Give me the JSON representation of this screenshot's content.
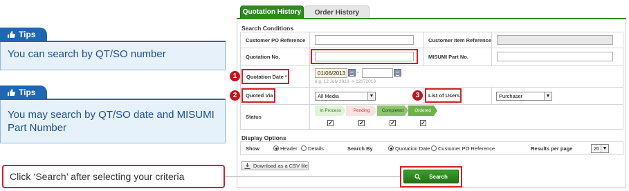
{
  "tips": [
    {
      "label": "Tips",
      "text": "You can search by QT/SO number"
    },
    {
      "label": "Tips",
      "text": "You may search by QT/SO date and MISUMI Part Number"
    }
  ],
  "hint": {
    "text": "Click ‘Search’ after selecting your criteria"
  },
  "tabs": [
    {
      "label": "Quotation History",
      "active": true
    },
    {
      "label": "Order History",
      "active": false
    }
  ],
  "search_conditions": {
    "title": "Search Conditions",
    "customer_po_label": "Customer PO Reference",
    "customer_po_value": "",
    "customer_item_label": "Customer Item Reference",
    "customer_item_value": "",
    "quotation_no_label": "Quotation No.",
    "quotation_no_value": "",
    "misumi_part_label": "MISUMI Part No.",
    "misumi_part_value": "",
    "quotation_date_label": "Quotation Date",
    "required_mark": "*",
    "date_from": "01/06/2013",
    "date_sep": "-",
    "date_to": "",
    "date_example": "e.g. 12 July 2013 -> 12072013",
    "quoted_via_label": "Quoted Via",
    "quoted_via_value": "All Media",
    "list_of_users_label": "List of Users",
    "list_of_users_value": "Purchaser",
    "status_label": "Status",
    "statuses": [
      {
        "label": "In Process",
        "color": "#e2f4d8",
        "text_color": "#2e7a20",
        "checked": true
      },
      {
        "label": "Pending",
        "color": "#f8e3e3",
        "text_color": "#c0392b",
        "checked": true
      },
      {
        "label": "Completed",
        "color": "#8dc46d",
        "text_color": "#1e4d12",
        "checked": true
      },
      {
        "label": "Ordered",
        "color": "#6cb24a",
        "text_color": "#ffffff",
        "checked": true
      }
    ],
    "badges": [
      "1",
      "2",
      "3"
    ]
  },
  "display_options": {
    "title": "Display Options",
    "show_label": "Show",
    "show_options": [
      "Header",
      "Details"
    ],
    "show_selected": "Header",
    "search_by_label": "Search By",
    "search_by_options": [
      "Quotation Date",
      "Customer PO Reference"
    ],
    "search_by_selected": "Quotation Date",
    "results_label": "Results per page",
    "results_value": "20"
  },
  "csv_button": "Download as a CSV file",
  "search_button": "Search",
  "colors": {
    "accent": "#2e8b1f",
    "tips_blue": "#1f67b3",
    "highlight_red": "#d11f26"
  }
}
